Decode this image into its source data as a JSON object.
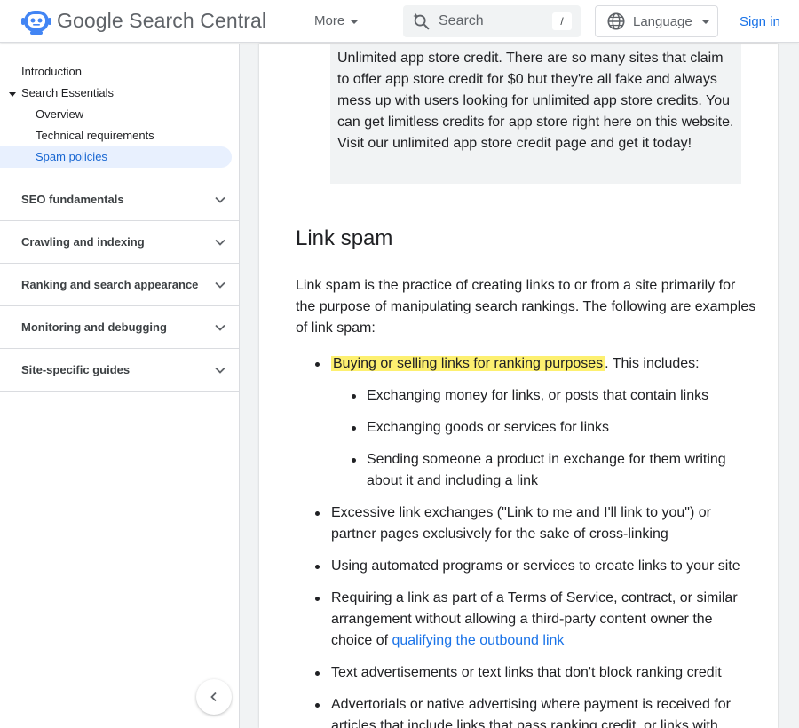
{
  "header": {
    "brand": "Google Search Central",
    "more": "More",
    "search_placeholder": "Search",
    "search_shortcut": "/",
    "language": "Language",
    "sign_in": "Sign in"
  },
  "sidebar": {
    "items": [
      {
        "label": "Introduction"
      },
      {
        "label": "Search Essentials"
      },
      {
        "label": "Overview"
      },
      {
        "label": "Technical requirements"
      },
      {
        "label": "Spam policies"
      }
    ],
    "sections": [
      {
        "label": "SEO fundamentals"
      },
      {
        "label": "Crawling and indexing"
      },
      {
        "label": "Ranking and search appearance"
      },
      {
        "label": "Monitoring and debugging"
      },
      {
        "label": "Site-specific guides"
      }
    ]
  },
  "main": {
    "quote": "Unlimited app store credit. There are so many sites that claim to offer app store credit for $0 but they're all fake and always mess up with users looking for unlimited app store credits. You can get limitless credits for app store right here on this website. Visit our unlimited app store credit page and get it today!",
    "heading": "Link spam",
    "intro": "Link spam is the practice of creating links to or from a site primarily for the purpose of manipulating search rankings. The following are examples of link spam:",
    "bullet1_highlight": "Buying or selling links for ranking purposes",
    "bullet1_rest": ". This includes:",
    "sub1": "Exchanging money for links, or posts that contain links",
    "sub2": "Exchanging goods or services for links",
    "sub3": "Sending someone a product in exchange for them writing about it and including a link",
    "bullet2": "Excessive link exchanges (\"Link to me and I'll link to you\") or partner pages exclusively for the sake of cross-linking",
    "bullet3": "Using automated programs or services to create links to your site",
    "bullet4_text": "Requiring a link as part of a Terms of Service, contract, or similar arrangement without allowing a third-party content owner the choice of ",
    "bullet4_link": "qualifying the outbound link",
    "bullet5": "Text advertisements or text links that don't block ranking credit",
    "bullet6": "Advertorials or native advertising where payment is received for articles that include links that pass ranking credit, or links with"
  },
  "colors": {
    "accent": "#1a73e8",
    "highlight": "#fdf070",
    "active_nav_bg": "#e8f0fe"
  }
}
